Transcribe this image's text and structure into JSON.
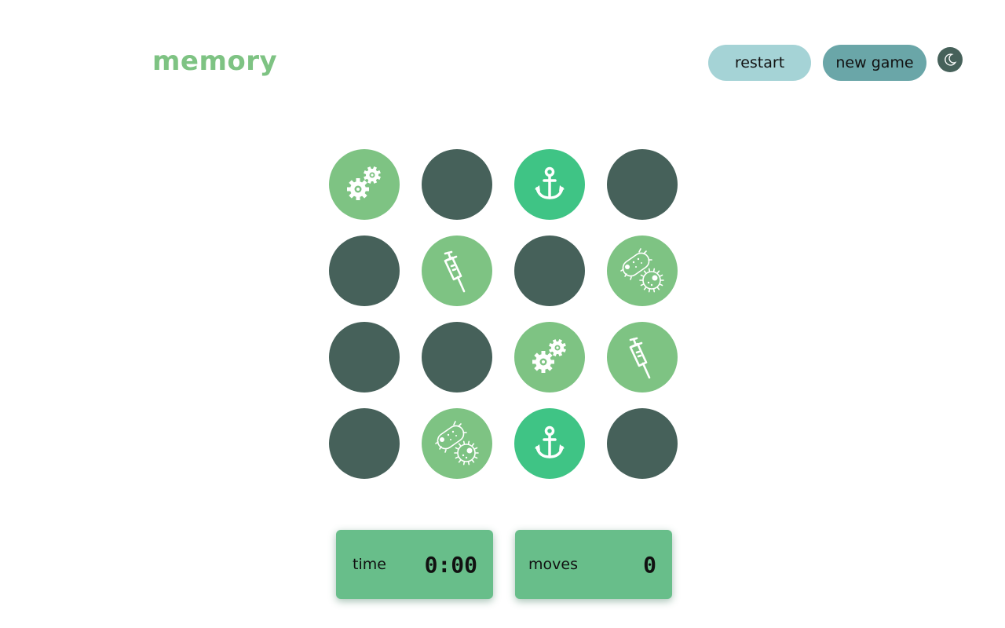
{
  "header": {
    "title": "memory",
    "restart_label": "restart",
    "new_game_label": "new game",
    "theme_toggle_icon": "moon-icon"
  },
  "board": {
    "rows": 4,
    "cols": 4,
    "tiles": [
      {
        "state": "flipped",
        "icon": "gears-icon"
      },
      {
        "state": "hidden",
        "icon": ""
      },
      {
        "state": "matched",
        "icon": "anchor-icon"
      },
      {
        "state": "hidden",
        "icon": ""
      },
      {
        "state": "hidden",
        "icon": ""
      },
      {
        "state": "flipped",
        "icon": "syringe-icon"
      },
      {
        "state": "hidden",
        "icon": ""
      },
      {
        "state": "flipped",
        "icon": "bacteria-icon"
      },
      {
        "state": "hidden",
        "icon": ""
      },
      {
        "state": "hidden",
        "icon": ""
      },
      {
        "state": "flipped",
        "icon": "gears-icon"
      },
      {
        "state": "flipped",
        "icon": "syringe-icon"
      },
      {
        "state": "hidden",
        "icon": ""
      },
      {
        "state": "flipped",
        "icon": "bacteria-icon"
      },
      {
        "state": "matched",
        "icon": "anchor-icon"
      },
      {
        "state": "hidden",
        "icon": ""
      }
    ]
  },
  "stats": {
    "time_label": "time",
    "time_value": "0:00",
    "moves_label": "moves",
    "moves_value": "0"
  },
  "colors": {
    "title": "#7ec383",
    "hidden_tile": "#46615a",
    "flipped_tile": "#7ec383",
    "matched_tile": "#3fc485",
    "restart_button": "#a5d3d6",
    "new_game_button": "#6aa6a8",
    "stat_panel": "#68be8a"
  }
}
